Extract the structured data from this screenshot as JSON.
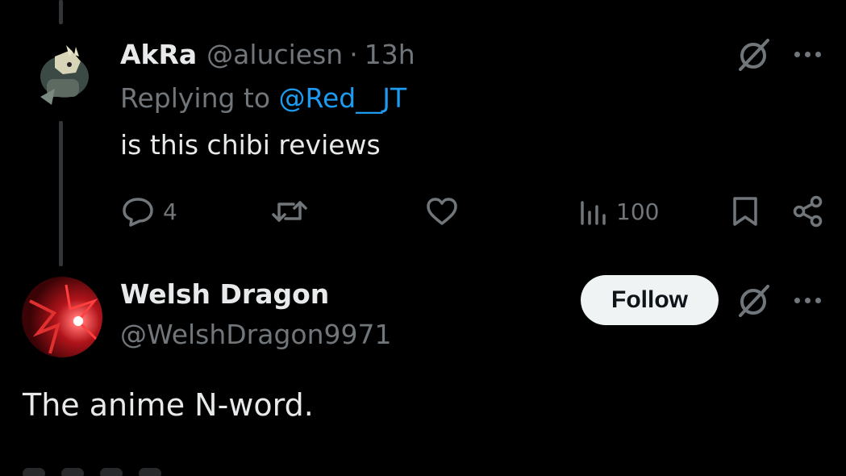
{
  "tweet1": {
    "display_name": "AkRa",
    "handle": "@aluciesn",
    "separator": "·",
    "time": "13h",
    "replying_to_prefix": "Replying to ",
    "replying_to_mention": "@Red__JT",
    "text": "is this chibi reviews",
    "reply_count": "4",
    "retweet_count": "",
    "like_count": "",
    "view_count": "100",
    "icons": [
      "reply-icon",
      "retweet-icon",
      "like-icon",
      "views-icon",
      "bookmark-icon",
      "share-icon",
      "grok-icon",
      "more-icon"
    ]
  },
  "tweet2": {
    "display_name": "Welsh Dragon",
    "handle": "@WelshDragon9971",
    "follow_label": "Follow",
    "text": "The anime N-word."
  },
  "colors": {
    "background": "#000000",
    "text_primary": "#e7e9ea",
    "text_secondary": "#71767b",
    "accent": "#1d9bf0",
    "button_bg": "#eff3f4"
  }
}
